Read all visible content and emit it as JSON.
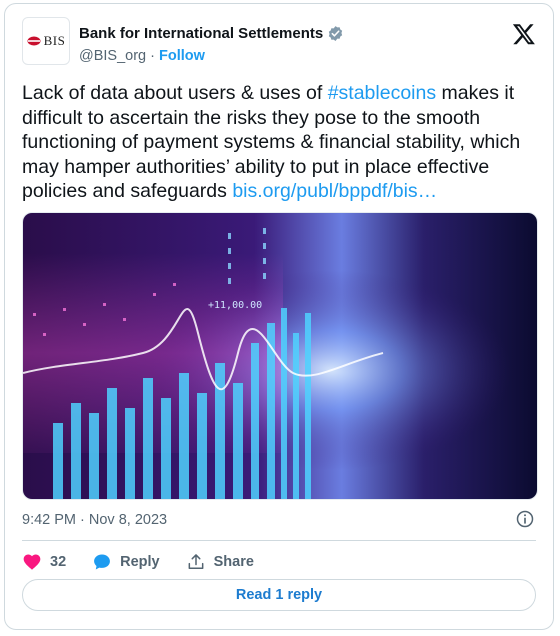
{
  "author": {
    "name": "Bank for International Settlements",
    "handle": "@BIS_org",
    "separator": "·",
    "follow_label": "Follow",
    "avatar_text": "BIS"
  },
  "tweet": {
    "text_1": "Lack of data about users & uses of ",
    "hashtag": "#stablecoins",
    "text_2": " makes it difficult to ascertain the risks they pose to the smooth functioning of payment systems & financial stability, which may hamper authorities’ ability to put in place effective policies and safeguards ",
    "link": "bis.org/publ/bppdf/bis…"
  },
  "media": {
    "overlay_text": "+11,00.00"
  },
  "meta": {
    "timestamp": "9:42 PM · Nov 8, 2023"
  },
  "actions": {
    "like_count": "32",
    "reply_label": "Reply",
    "share_label": "Share"
  },
  "read_replies_label": "Read 1 reply",
  "colors": {
    "accent": "#1d9bf0",
    "like": "#f91880",
    "text": "#0f1419",
    "secondary": "#536471"
  },
  "icons": [
    "verified-badge-icon",
    "x-logo-icon",
    "info-icon",
    "heart-icon",
    "reply-bubble-icon",
    "share-icon"
  ]
}
